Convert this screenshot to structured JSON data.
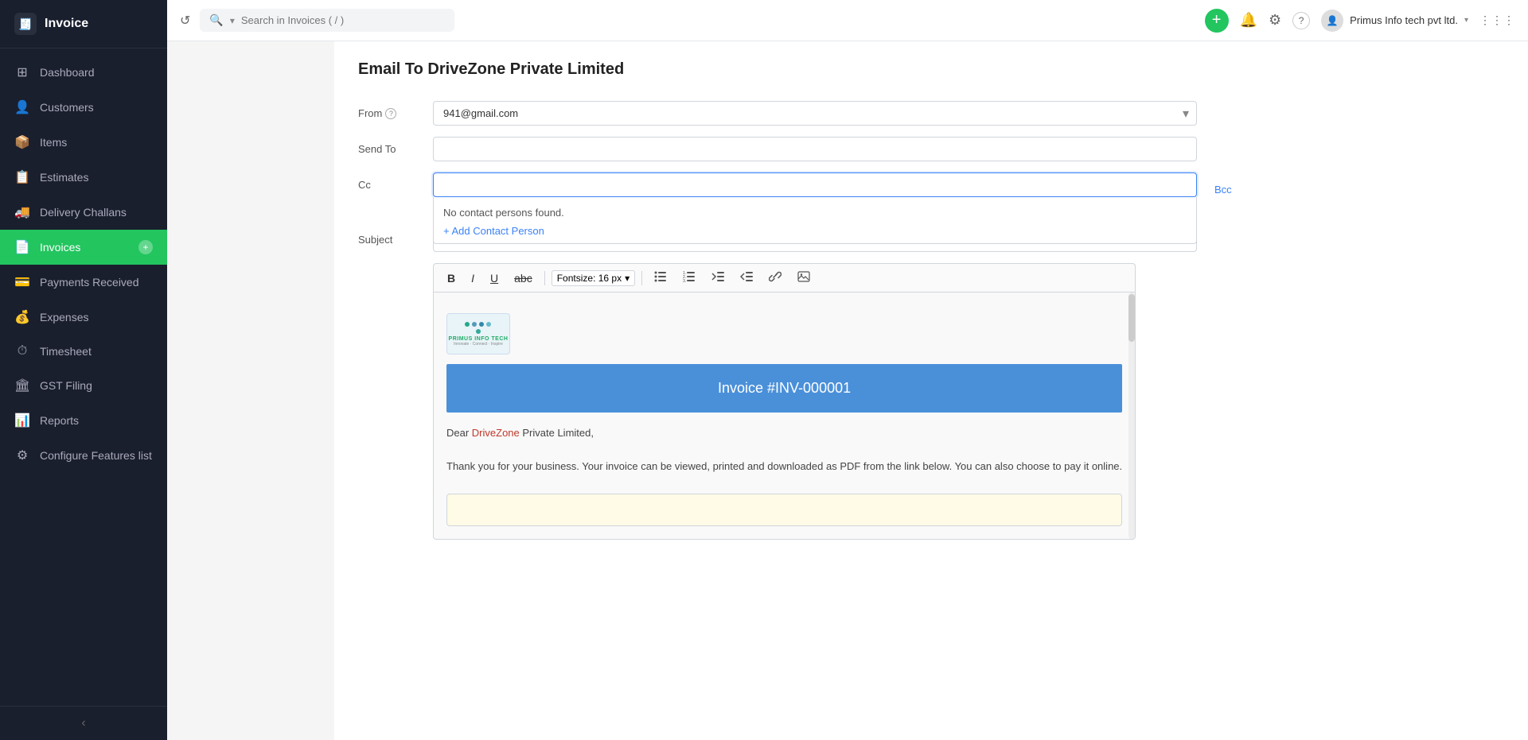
{
  "app": {
    "logo_text": "Invoice",
    "logo_icon": "🧾"
  },
  "sidebar": {
    "items": [
      {
        "id": "dashboard",
        "label": "Dashboard",
        "icon": "⊞",
        "active": false
      },
      {
        "id": "customers",
        "label": "Customers",
        "icon": "👤",
        "active": false
      },
      {
        "id": "items",
        "label": "Items",
        "icon": "📦",
        "active": false
      },
      {
        "id": "estimates",
        "label": "Estimates",
        "icon": "📋",
        "active": false
      },
      {
        "id": "delivery-challans",
        "label": "Delivery Challans",
        "icon": "🚚",
        "active": false
      },
      {
        "id": "invoices",
        "label": "Invoices",
        "icon": "📄",
        "active": true
      },
      {
        "id": "payments-received",
        "label": "Payments Received",
        "icon": "💳",
        "active": false
      },
      {
        "id": "expenses",
        "label": "Expenses",
        "icon": "💰",
        "active": false
      },
      {
        "id": "timesheet",
        "label": "Timesheet",
        "icon": "⏱",
        "active": false
      },
      {
        "id": "gst-filing",
        "label": "GST Filing",
        "icon": "🏛",
        "active": false
      },
      {
        "id": "reports",
        "label": "Reports",
        "icon": "📊",
        "active": false
      },
      {
        "id": "configure",
        "label": "Configure Features list",
        "icon": "⚙",
        "active": false
      }
    ],
    "collapse_label": "‹"
  },
  "topbar": {
    "search_placeholder": "Search in Invoices ( / )",
    "add_btn_label": "+",
    "user_name": "Primus Info tech pvt ltd.",
    "icons": {
      "refresh": "↺",
      "bell": "🔔",
      "settings": "⚙",
      "help": "?",
      "grid": "⋮⋮⋮"
    }
  },
  "page": {
    "title": "Email To DriveZone Private Limited",
    "form": {
      "from_label": "From",
      "from_info_icon": "?",
      "from_value": "941@gmail.com",
      "send_to_label": "Send To",
      "send_to_value": "",
      "cc_label": "Cc",
      "cc_value": "",
      "bcc_label": "Bcc",
      "subject_label": "Subject",
      "subject_value": "",
      "no_contact_text": "No contact persons found.",
      "add_contact_label": "+ Add Contact Person"
    },
    "toolbar": {
      "bold": "B",
      "italic": "I",
      "underline": "U",
      "strikethrough": "abc",
      "fontsize_label": "Fontsize: 16 px",
      "fontsize_arrow": "▾"
    },
    "email_body": {
      "banner_text": "Invoice #INV-000001",
      "banner_color": "#4a90d9",
      "dear_text": "Dear ",
      "company_link": "DriveZone",
      "company_suffix": " Private Limited,",
      "paragraph1": "Thank you for your business. Your invoice can be viewed, printed and downloaded as PDF from the link below. You can also choose to pay it online.",
      "cta_placeholder": ""
    }
  }
}
